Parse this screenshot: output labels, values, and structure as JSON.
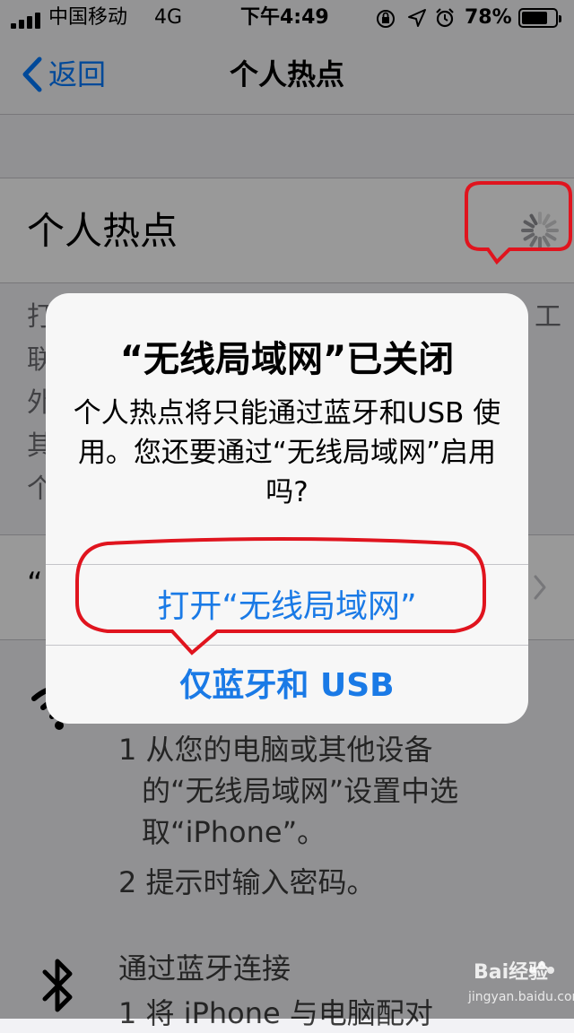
{
  "status_bar": {
    "carrier": "中国移动",
    "network": "4G",
    "time": "下午4:49",
    "battery": "78%",
    "battery_level": 0.78,
    "icons": [
      "orientation-lock-icon",
      "location-icon",
      "alarm-icon"
    ]
  },
  "nav": {
    "back_label": "返回",
    "title": "个人热点"
  },
  "settings": {
    "hotspot_label": "个人热点",
    "description_first_chars": [
      "打",
      "联",
      "外",
      "其",
      "个"
    ],
    "description_last_chars": [
      "工"
    ],
    "wlan_row_prefix": "“",
    "instructions": {
      "step1_line1": "1 从您的电脑或其他设备",
      "step1_line2": "的“无线局域网”设置中选",
      "step1_line3": "取“iPhone”。",
      "step2": "2 提示时输入密码。",
      "bluetooth_title": "通过蓝牙连接",
      "bluetooth_step1": "1 将 iPhone 与电脑配对"
    }
  },
  "alert": {
    "title": "“无线局域网”已关闭",
    "message": "个人热点将只能通过蓝牙和USB 使用。您还要通过“无线局域网”启用吗?",
    "button_primary": "打开“无线局域网”",
    "button_secondary": "仅蓝牙和 USB"
  },
  "watermark": {
    "brand": "Bai",
    "brand_suffix": "经验",
    "url": "jingyan.baidu.com"
  },
  "colors": {
    "accent": "#007aff",
    "alert_button": "#1a7ae6",
    "annotation": "#e0141e",
    "overlay": "rgba(0,0,0,0.40)"
  }
}
